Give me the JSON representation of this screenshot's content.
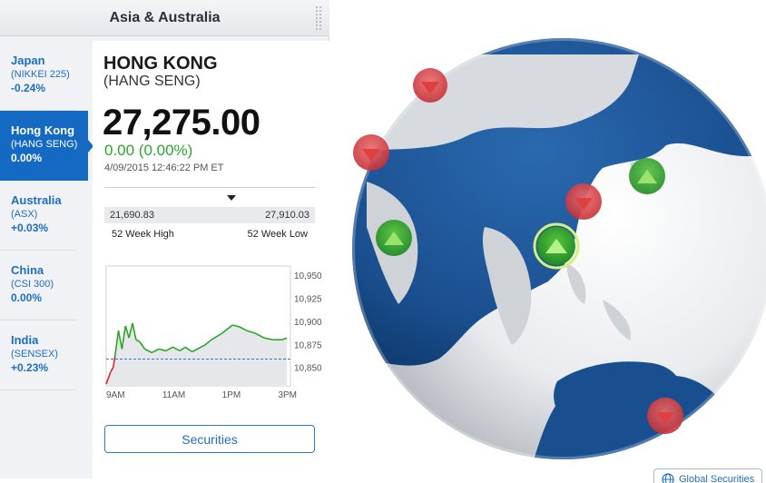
{
  "header": {
    "title": "Asia & Australia"
  },
  "markets": [
    {
      "name": "Japan",
      "index": "(NIKKEI 225)",
      "change": "-0.24%",
      "active": false
    },
    {
      "name": "Hong Kong",
      "index": "(HANG SENG)",
      "change": "0.00%",
      "active": true
    },
    {
      "name": "Australia",
      "index": "(ASX)",
      "change": "+0.03%",
      "active": false
    },
    {
      "name": "China",
      "index": "(CSI 300)",
      "change": "0.00%",
      "active": false
    },
    {
      "name": "India",
      "index": "(SENSEX)",
      "change": "+0.23%",
      "active": false
    }
  ],
  "detail": {
    "title": "HONG KONG",
    "subtitle": "(HANG SENG)",
    "price": "27,275.00",
    "change": "0.00 (0.00%)",
    "timestamp": "4/09/2015 12:46:22 PM ET",
    "week52_low_value": "21,690.83",
    "week52_high_value": "27,910.03",
    "week52_high_label": "52 Week High",
    "week52_low_label": "52 Week Low",
    "securities_label": "Securities"
  },
  "chart_data": {
    "type": "line",
    "x_ticks": [
      "9AM",
      "11AM",
      "1PM",
      "3PM"
    ],
    "y_ticks": [
      "10,950",
      "10,925",
      "10,900",
      "10,875",
      "10,850"
    ],
    "ylim": [
      10830,
      10960
    ],
    "baseline": 10859,
    "series": [
      {
        "values": [
          [
            0.0,
            10832
          ],
          [
            0.25,
            10845
          ],
          [
            0.4,
            10850
          ],
          [
            0.5,
            10862
          ],
          [
            0.7,
            10890
          ],
          [
            0.9,
            10870
          ],
          [
            1.1,
            10895
          ],
          [
            1.3,
            10882
          ],
          [
            1.5,
            10898
          ],
          [
            1.7,
            10880
          ],
          [
            1.9,
            10878
          ],
          [
            2.2,
            10870
          ],
          [
            2.6,
            10866
          ],
          [
            3.0,
            10870
          ],
          [
            3.4,
            10868
          ],
          [
            3.8,
            10872
          ],
          [
            4.2,
            10868
          ],
          [
            4.5,
            10872
          ],
          [
            4.9,
            10867
          ],
          [
            5.2,
            10870
          ],
          [
            5.6,
            10874
          ],
          [
            6.0,
            10880
          ],
          [
            6.6,
            10887
          ],
          [
            7.2,
            10896
          ],
          [
            7.6,
            10894
          ],
          [
            8.0,
            10890
          ],
          [
            8.5,
            10887
          ],
          [
            9.0,
            10882
          ],
          [
            9.5,
            10880
          ],
          [
            10.0,
            10880
          ],
          [
            10.3,
            10882
          ]
        ]
      }
    ],
    "colors": {
      "up": "#2ba62b",
      "down": "#d22b2b",
      "baseline": "#2b7ad6"
    }
  },
  "globe": {
    "markers": [
      {
        "label": "Japan",
        "direction": "down"
      },
      {
        "label": "Hong Kong",
        "direction": "up",
        "selected": true
      },
      {
        "label": "Australia",
        "direction": "up"
      },
      {
        "label": "China",
        "direction": "down"
      },
      {
        "label": "India",
        "direction": "up"
      }
    ]
  },
  "footer": {
    "global_securities_label": "Global Securities"
  },
  "colors": {
    "accent": "#1469c2",
    "positive": "#2ba62b",
    "negative": "#d22b2b",
    "ocean": "#1a4f8f"
  }
}
